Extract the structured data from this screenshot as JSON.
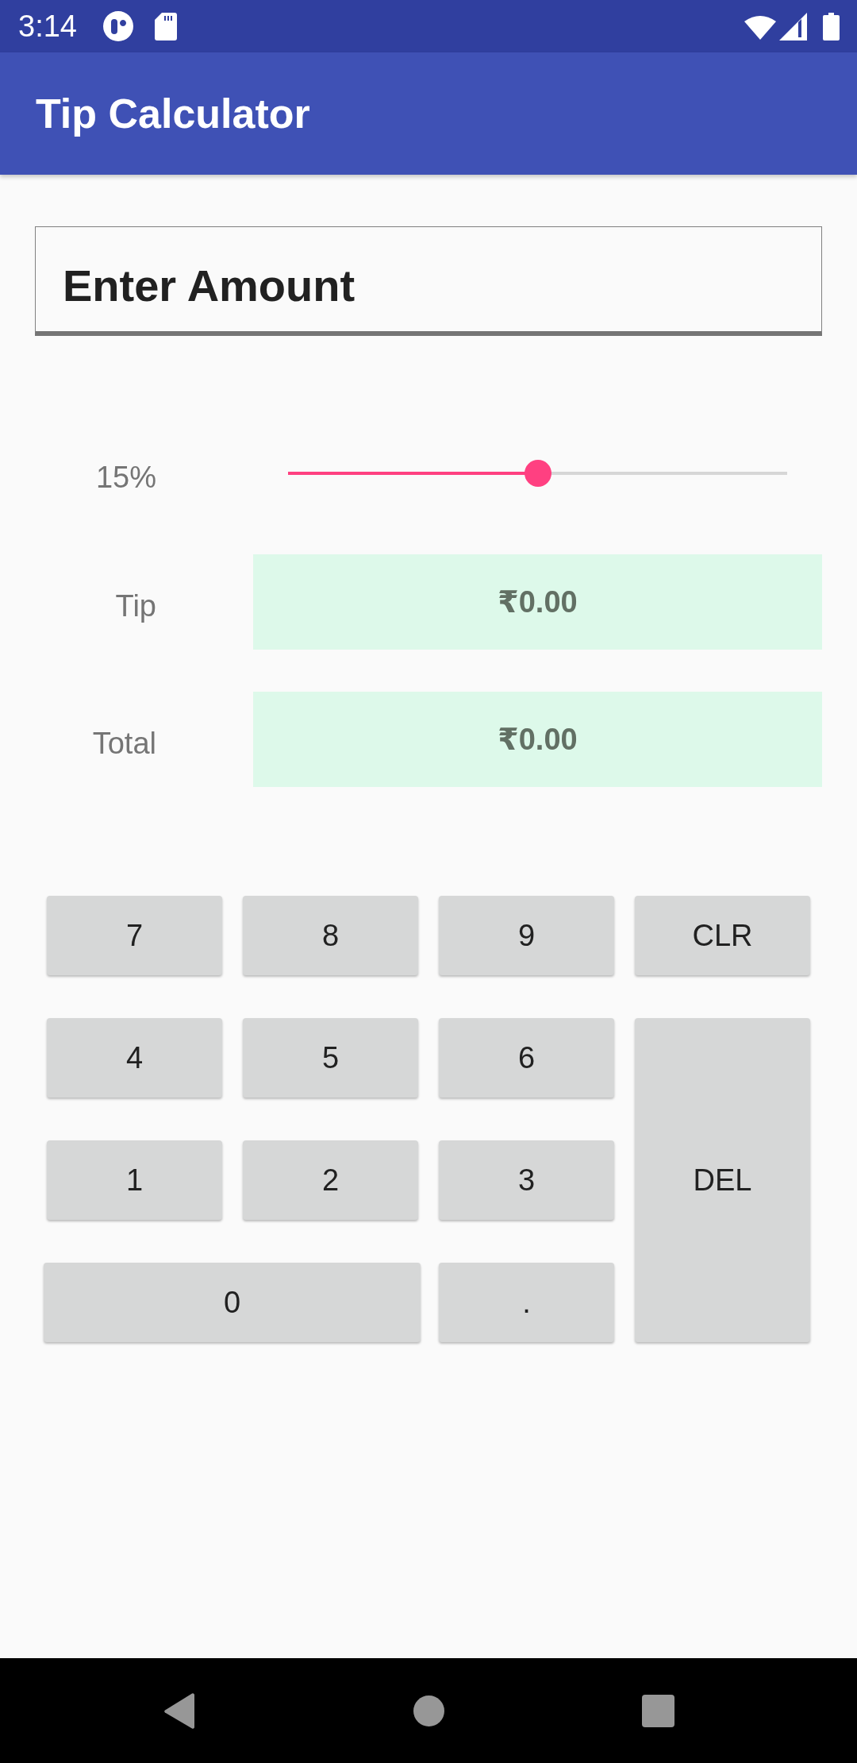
{
  "status_bar": {
    "time": "3:14"
  },
  "app_bar": {
    "title": "Tip Calculator"
  },
  "amount_field": {
    "placeholder": "Enter Amount"
  },
  "tip_slider": {
    "label": "15%",
    "level": 0.5
  },
  "results": [
    {
      "label": "Tip",
      "value": "₹0.00"
    },
    {
      "label": "Total",
      "value": "₹0.00"
    }
  ],
  "keypad": [
    {
      "label": "7",
      "kind": "key"
    },
    {
      "label": "8",
      "kind": "key"
    },
    {
      "label": "9",
      "kind": "key"
    },
    {
      "label": "CLR",
      "kind": "key"
    },
    {
      "label": "4",
      "kind": "key"
    },
    {
      "label": "5",
      "kind": "key"
    },
    {
      "label": "6",
      "kind": "key"
    },
    {
      "label": "1",
      "kind": "key"
    },
    {
      "label": "2",
      "kind": "key"
    },
    {
      "label": "3",
      "kind": "key"
    },
    {
      "label": "DEL",
      "kind": "tall"
    },
    {
      "label": "0",
      "kind": "wide"
    },
    {
      "label": ".",
      "kind": "key"
    }
  ]
}
